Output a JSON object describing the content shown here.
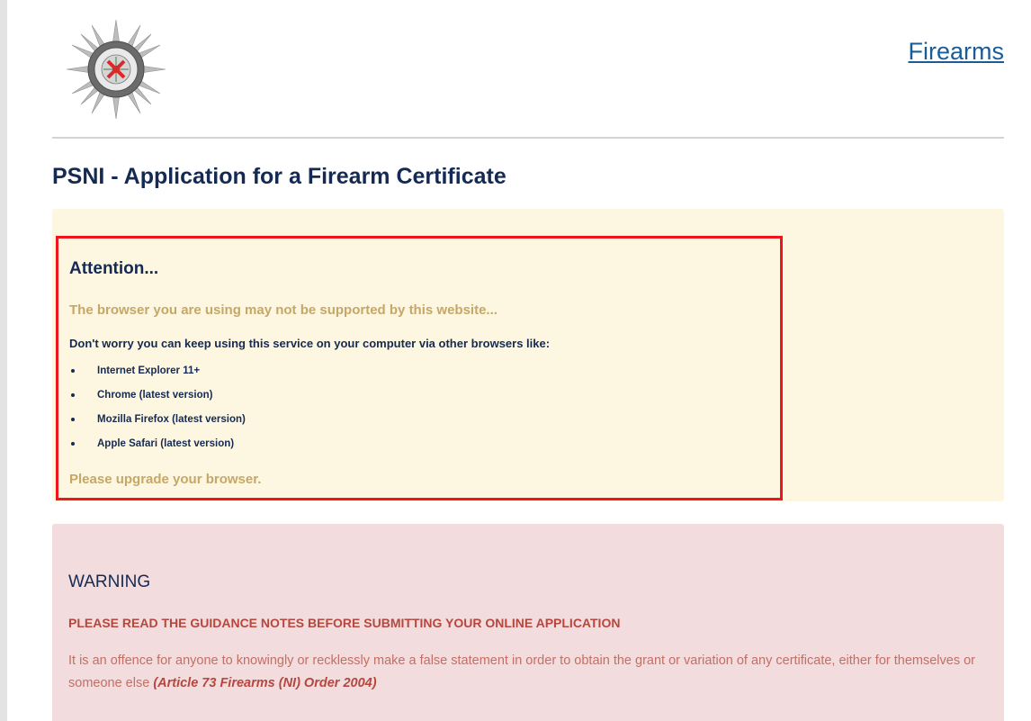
{
  "header": {
    "logo_icon": "psni-crest-icon",
    "link_label": "Firearms"
  },
  "page": {
    "title": "PSNI - Application for a Firearm Certificate"
  },
  "attention": {
    "title": "Attention...",
    "lead": "The browser you are using may not be supported by this website...",
    "subtitle": "Don't worry you can keep using this service on your computer via other browsers like:",
    "browsers": [
      "Internet Explorer 11+",
      "Chrome (latest version)",
      "Mozilla Firefox (latest version)",
      "Apple Safari (latest version)"
    ],
    "footer": "Please upgrade your browser."
  },
  "warning": {
    "title": "WARNING",
    "lead": "PLEASE READ THE GUIDANCE NOTES BEFORE SUBMITTING YOUR ONLINE APPLICATION",
    "body": "It is an offence for anyone to knowingly or recklessly make a false statement in order to obtain the grant or variation of any certificate, either for themselves or someone else",
    "citation": "(Article 73 Firearms (NI) Order 2004)"
  },
  "colors": {
    "navy": "#152a53",
    "link": "#1a5c96",
    "gold": "#c5a768",
    "notice_bg": "#fdf7e1",
    "highlight_border": "#f0151c",
    "warning_bg": "#f3dcdd",
    "warning_red": "#b5473f"
  }
}
